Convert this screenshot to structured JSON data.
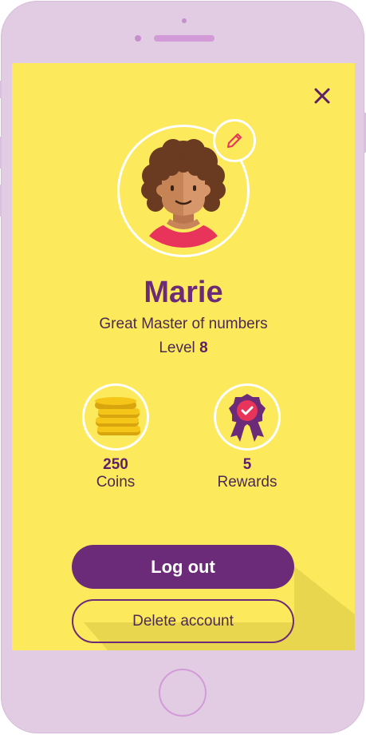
{
  "colors": {
    "screen_bg": "#fde95c",
    "accent_purple": "#6c2b78",
    "phone_frame": "#e2cce4"
  },
  "header": {
    "close_icon": "close-icon"
  },
  "profile": {
    "name": "Marie",
    "title": "Great Master of numbers",
    "level_label": "Level",
    "level_value": "8",
    "edit_icon": "pencil-icon"
  },
  "stats": {
    "coins": {
      "value": "250",
      "label": "Coins",
      "icon": "coins-stack-icon"
    },
    "rewards": {
      "value": "5",
      "label": "Rewards",
      "icon": "award-ribbon-icon"
    }
  },
  "actions": {
    "logout_label": "Log out",
    "delete_label": "Delete account"
  }
}
